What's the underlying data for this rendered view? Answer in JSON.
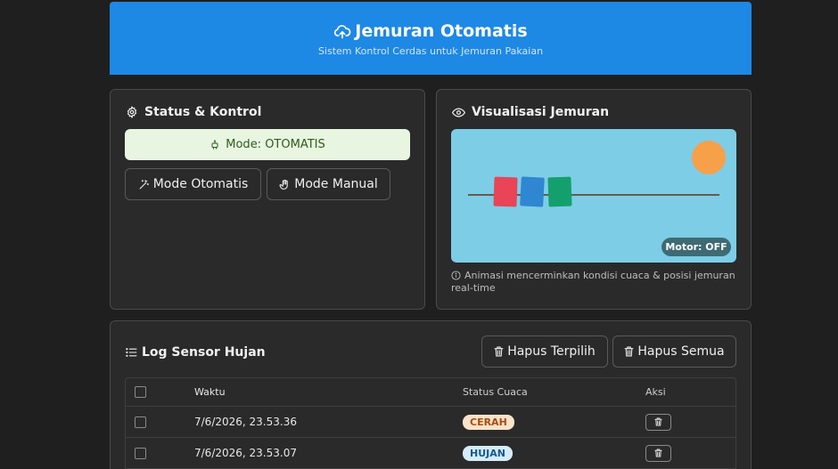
{
  "header": {
    "title": "Jemuran Otomatis",
    "subtitle": "Sistem Kontrol Cerdas untuk Jemuran Pakaian",
    "icon": "cloud-upload-icon"
  },
  "status_card": {
    "title": "Status & Kontrol",
    "mode_label": "Mode: OTOMATIS",
    "buttons": {
      "auto": "Mode Otomatis",
      "manual": "Mode Manual"
    }
  },
  "visual_card": {
    "title": "Visualisasi Jemuran",
    "motor_status": "Motor: OFF",
    "note": "Animasi mencerminkan kondisi cuaca & posisi jemuran real-time",
    "clothes_colors": [
      "#e94457",
      "#2f86d1",
      "#14a06c"
    ],
    "sky_color": "#7dcde6",
    "sun_color": "#f6a04a"
  },
  "log_card": {
    "title": "Log Sensor Hujan",
    "buttons": {
      "delete_selected": "Hapus Terpilih",
      "delete_all": "Hapus Semua"
    },
    "columns": [
      "Waktu",
      "Status Cuaca",
      "Aksi"
    ],
    "rows": [
      {
        "time": "7/6/2026, 23.53.36",
        "status": "CERAH"
      },
      {
        "time": "7/6/2026, 23.53.07",
        "status": "HUJAN"
      }
    ]
  },
  "colors": {
    "header_bg": "#1e88e5",
    "mode_banner_bg": "#e8f5e1",
    "badge_cerah": "#fbe3cb",
    "badge_hujan": "#d6ecfb"
  }
}
